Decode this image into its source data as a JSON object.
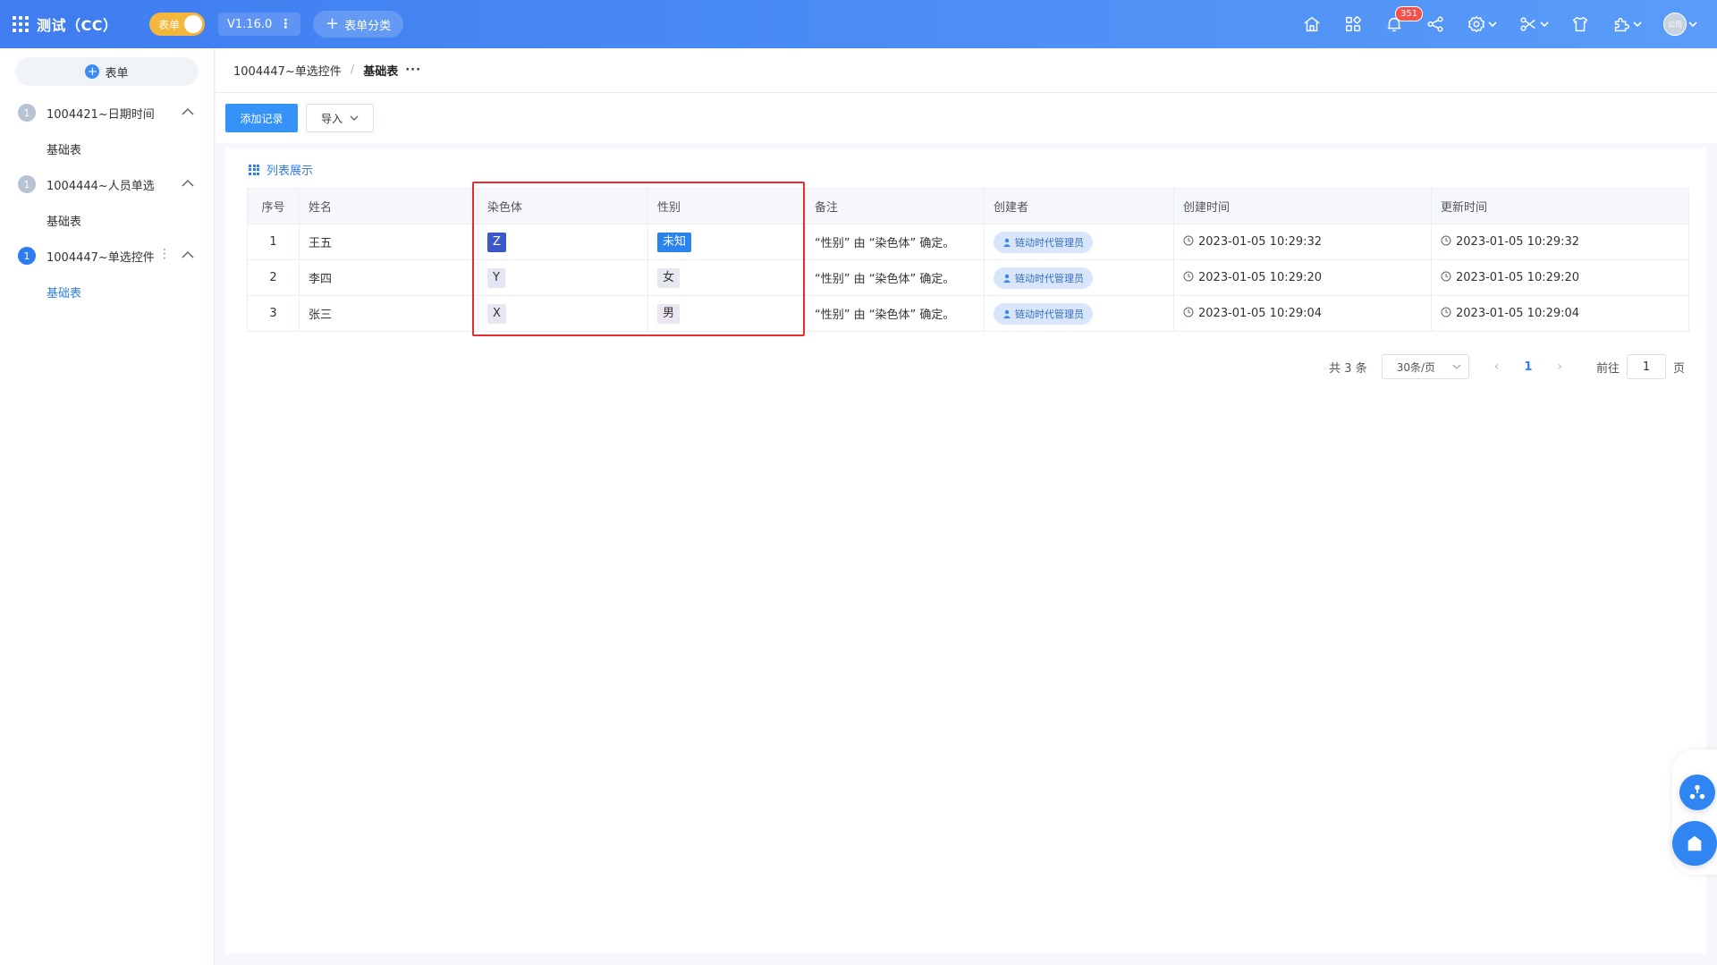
{
  "topbar": {
    "title": "测试（CC）",
    "toggle_label": "表单",
    "version": "V1.16.0",
    "category_button": "表单分类",
    "notification_count": "351",
    "avatar_text": "公司"
  },
  "sidebar": {
    "add_form": "表单",
    "groups": [
      {
        "num": "1",
        "label": "1004421~日期时间",
        "sub": "基础表"
      },
      {
        "num": "1",
        "label": "1004444~人员单选",
        "sub": "基础表"
      },
      {
        "num": "1",
        "label": "1004447~单选控件",
        "sub": "基础表"
      }
    ]
  },
  "breadcrumb": {
    "parent": "1004447~单选控件",
    "separator": "/",
    "current": "基础表",
    "more": "···"
  },
  "toolbar": {
    "add_record": "添加记录",
    "import": "导入"
  },
  "view": {
    "label": "列表展示"
  },
  "table": {
    "headers": [
      "序号",
      "姓名",
      "染色体",
      "性别",
      "备注",
      "创建者",
      "创建时间",
      "更新时间"
    ],
    "rows": [
      {
        "index": "1",
        "name": "王五",
        "chromosome": "Z",
        "gender": "未知",
        "note": "“性别” 由 “染色体” 确定。",
        "creator": "链动时代管理员",
        "created": "2023-01-05 10:29:32",
        "updated": "2023-01-05 10:29:32"
      },
      {
        "index": "2",
        "name": "李四",
        "chromosome": "Y",
        "gender": "女",
        "note": "“性别” 由 “染色体” 确定。",
        "creator": "链动时代管理员",
        "created": "2023-01-05 10:29:20",
        "updated": "2023-01-05 10:29:20"
      },
      {
        "index": "3",
        "name": "张三",
        "chromosome": "X",
        "gender": "男",
        "note": "“性别” 由 “染色体” 确定。",
        "creator": "链动时代管理员",
        "created": "2023-01-05 10:29:04",
        "updated": "2023-01-05 10:29:04"
      }
    ]
  },
  "pagination": {
    "total": "共 3 条",
    "page_size": "30条/页",
    "prev": "‹",
    "current_page": "1",
    "next": "›",
    "goto_label": "前往",
    "goto_value": "1",
    "page_suffix": "页"
  },
  "colors": {
    "primary": "#3592f7",
    "highlight_border": "#e52f2f",
    "badge": "#f5504c"
  }
}
